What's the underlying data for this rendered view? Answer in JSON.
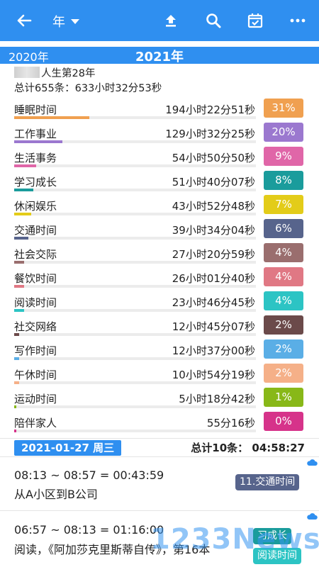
{
  "header": {
    "title": "年",
    "icons": [
      "back-arrow-icon",
      "upload-icon",
      "search-icon",
      "calendar-check-icon",
      "more-icon"
    ]
  },
  "year_bar": {
    "prev_year": "2020年",
    "current_year": "2021年"
  },
  "summary": {
    "life_label": "人生第28年",
    "total": "总计655条：633小时32分53秒"
  },
  "categories": [
    {
      "name": "睡眠时间",
      "duration": "194小时22分51秒",
      "percent": "31%",
      "share": 0.31,
      "color": "#f0a050"
    },
    {
      "name": "工作事业",
      "duration": "129小时32分25秒",
      "percent": "20%",
      "share": 0.2,
      "color": "#9b78cf"
    },
    {
      "name": "生活事务",
      "duration": "54小时50分50秒",
      "percent": "9%",
      "share": 0.09,
      "color": "#e066a8"
    },
    {
      "name": "学习成长",
      "duration": "51小时40分07秒",
      "percent": "8%",
      "share": 0.08,
      "color": "#1a9c9c"
    },
    {
      "name": "休闲娱乐",
      "duration": "43小时52分48秒",
      "percent": "7%",
      "share": 0.07,
      "color": "#e3cc19"
    },
    {
      "name": "交通时间",
      "duration": "39小时34分04秒",
      "percent": "6%",
      "share": 0.06,
      "color": "#57648c"
    },
    {
      "name": "社会交际",
      "duration": "27小时20分59秒",
      "percent": "4%",
      "share": 0.04,
      "color": "#9a6e6e"
    },
    {
      "name": "餐饮时间",
      "duration": "26小时01分40秒",
      "percent": "4%",
      "share": 0.04,
      "color": "#e07884"
    },
    {
      "name": "阅读时间",
      "duration": "23小时46分45秒",
      "percent": "4%",
      "share": 0.04,
      "color": "#2cc4c4"
    },
    {
      "name": "社交网络",
      "duration": "12小时45分07秒",
      "percent": "2%",
      "share": 0.02,
      "color": "#6b4a4a"
    },
    {
      "name": "写作时间",
      "duration": "12小时37分00秒",
      "percent": "2%",
      "share": 0.02,
      "color": "#5aaee6"
    },
    {
      "name": "午休时间",
      "duration": "10小时54分19秒",
      "percent": "2%",
      "share": 0.02,
      "color": "#f5b088"
    },
    {
      "name": "运动时间",
      "duration": "5小时18分42秒",
      "percent": "1%",
      "share": 0.01,
      "color": "#88b818"
    },
    {
      "name": "陪伴家人",
      "duration": "55分16秒",
      "percent": "0%",
      "share": 0.0,
      "color": "#d6338a"
    }
  ],
  "day": {
    "date": "2021-01-27 周三",
    "total": "总计10条： 04:58:27"
  },
  "entries": [
    {
      "time": "08:13 ~ 08:57 = 00:43:59",
      "desc": "从A小区到B公司",
      "tags": [
        {
          "label": "11.交通时间",
          "color": "#57648c"
        }
      ]
    },
    {
      "time": "06:57 ~ 08:13 = 01:16:00",
      "desc": "阅读，《阿加莎克里斯蒂自传》，第16本",
      "tags": [
        {
          "label": "习成长",
          "color": "#1a9c9c"
        },
        {
          "label": "阅读时间",
          "color": "#2cc4c4"
        }
      ]
    }
  ],
  "watermark": "1233News"
}
